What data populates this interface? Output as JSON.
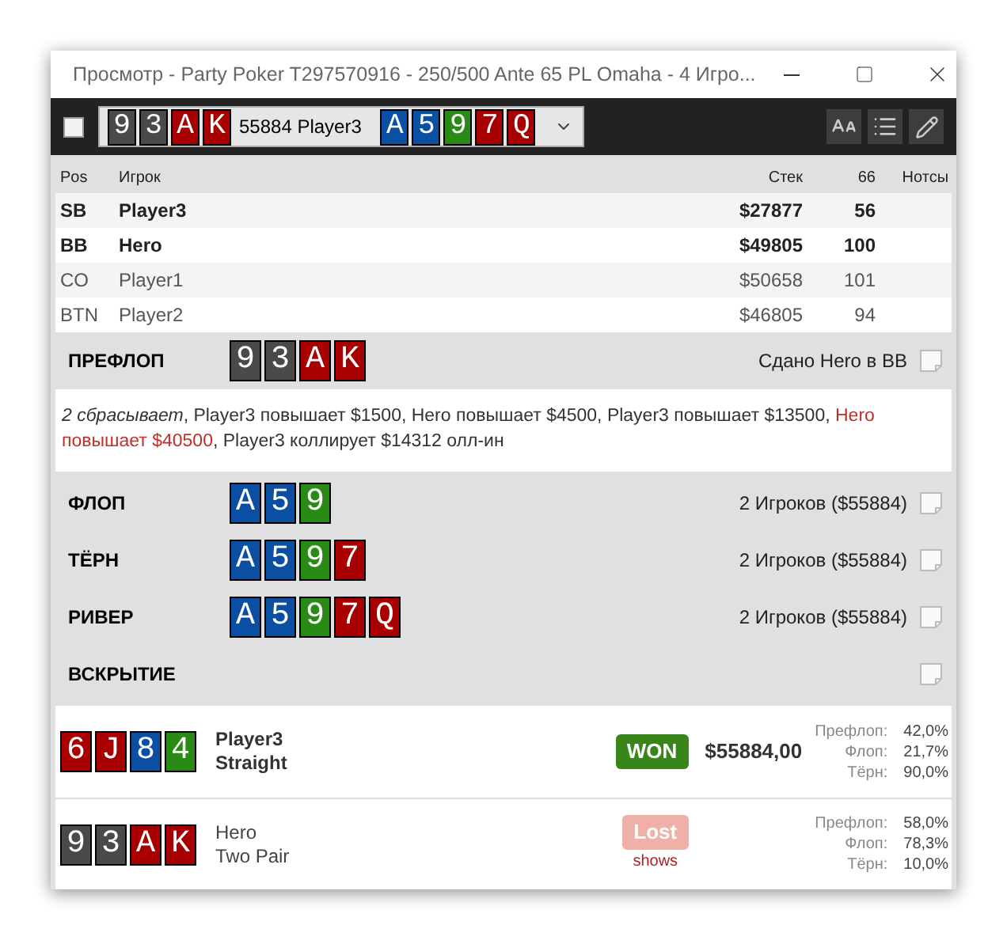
{
  "window": {
    "title": "Просмотр - Party Poker T297570916 - 250/500 Ante 65 PL Omaha - 4 Игро..."
  },
  "toolbar": {
    "checked": false,
    "hand_selector": {
      "hole_cards": [
        {
          "rank": "9",
          "color": "#4a4a4a"
        },
        {
          "rank": "3",
          "color": "#4a4a4a"
        },
        {
          "rank": "A",
          "color": "#a80000"
        },
        {
          "rank": "K",
          "color": "#a80000"
        }
      ],
      "label": "55884 Player3",
      "board": [
        {
          "rank": "A",
          "color": "#0b4fa3"
        },
        {
          "rank": "5",
          "color": "#0b4fa3"
        },
        {
          "rank": "9",
          "color": "#2a8a16"
        },
        {
          "rank": "7",
          "color": "#a80000"
        },
        {
          "rank": "Q",
          "color": "#a80000"
        }
      ]
    }
  },
  "players_table": {
    "columns": [
      "Pos",
      "Игрок",
      "Стек",
      "66",
      "Нотсы"
    ],
    "rows": [
      {
        "pos": "SB",
        "player": "Player3",
        "stack": "$27877",
        "bb": "56",
        "in_hand": true
      },
      {
        "pos": "BB",
        "player": "Hero",
        "stack": "$49805",
        "bb": "100",
        "in_hand": true
      },
      {
        "pos": "CO",
        "player": "Player1",
        "stack": "$50658",
        "bb": "101",
        "in_hand": false
      },
      {
        "pos": "BTN",
        "player": "Player2",
        "stack": "$46805",
        "bb": "94",
        "in_hand": false
      }
    ]
  },
  "preflop": {
    "title": "ПРЕФЛОП",
    "cards": [
      {
        "rank": "9",
        "color": "#4a4a4a"
      },
      {
        "rank": "3",
        "color": "#4a4a4a"
      },
      {
        "rank": "A",
        "color": "#a80000"
      },
      {
        "rank": "K",
        "color": "#a80000"
      }
    ],
    "info": "Сдано Hero в BB",
    "actions": [
      {
        "kind": "fold",
        "text": "2 сбрасывает"
      },
      {
        "kind": "plain",
        "text": ", Player3 повышает $1500, Hero повышает $4500, Player3 повышает $13500, "
      },
      {
        "kind": "hero",
        "text": "Hero повышает $40500"
      },
      {
        "kind": "plain",
        "text": ", Player3 коллирует $14312 олл-ин"
      }
    ]
  },
  "streets": [
    {
      "title": "ФЛОП",
      "cards": [
        {
          "rank": "A",
          "color": "#0b4fa3"
        },
        {
          "rank": "5",
          "color": "#0b4fa3"
        },
        {
          "rank": "9",
          "color": "#2a8a16"
        }
      ],
      "info": "2 Игроков ($55884)"
    },
    {
      "title": "ТЁРН",
      "cards": [
        {
          "rank": "A",
          "color": "#0b4fa3"
        },
        {
          "rank": "5",
          "color": "#0b4fa3"
        },
        {
          "rank": "9",
          "color": "#2a8a16"
        },
        {
          "rank": "7",
          "color": "#a80000"
        }
      ],
      "info": "2 Игроков ($55884)"
    },
    {
      "title": "РИВЕР",
      "cards": [
        {
          "rank": "A",
          "color": "#0b4fa3"
        },
        {
          "rank": "5",
          "color": "#0b4fa3"
        },
        {
          "rank": "9",
          "color": "#2a8a16"
        },
        {
          "rank": "7",
          "color": "#a80000"
        },
        {
          "rank": "Q",
          "color": "#a80000"
        }
      ],
      "info": "2 Игроков ($55884)"
    },
    {
      "title": "ВСКРЫТИЕ"
    }
  ],
  "results": [
    {
      "cards": [
        {
          "rank": "6",
          "color": "#a80000"
        },
        {
          "rank": "J",
          "color": "#a80000"
        },
        {
          "rank": "8",
          "color": "#0b4fa3"
        },
        {
          "rank": "4",
          "color": "#2a8a16"
        }
      ],
      "player": "Player3",
      "hand": "Straight",
      "kind": "won",
      "badge": "WON",
      "amount": "$55884,00",
      "equity": [
        {
          "label": "Префлоп:",
          "value": "42,0%"
        },
        {
          "label": "Флоп:",
          "value": "21,7%"
        },
        {
          "label": "Тёрн:",
          "value": "90,0%"
        }
      ]
    },
    {
      "cards": [
        {
          "rank": "9",
          "color": "#4a4a4a"
        },
        {
          "rank": "3",
          "color": "#4a4a4a"
        },
        {
          "rank": "A",
          "color": "#a80000"
        },
        {
          "rank": "K",
          "color": "#a80000"
        }
      ],
      "player": "Hero",
      "hand": "Two Pair",
      "kind": "lost",
      "badge": "Lost",
      "note": "shows",
      "equity": [
        {
          "label": "Префлоп:",
          "value": "58,0%"
        },
        {
          "label": "Флоп:",
          "value": "78,3%"
        },
        {
          "label": "Тёрн:",
          "value": "10,0%"
        }
      ]
    }
  ]
}
